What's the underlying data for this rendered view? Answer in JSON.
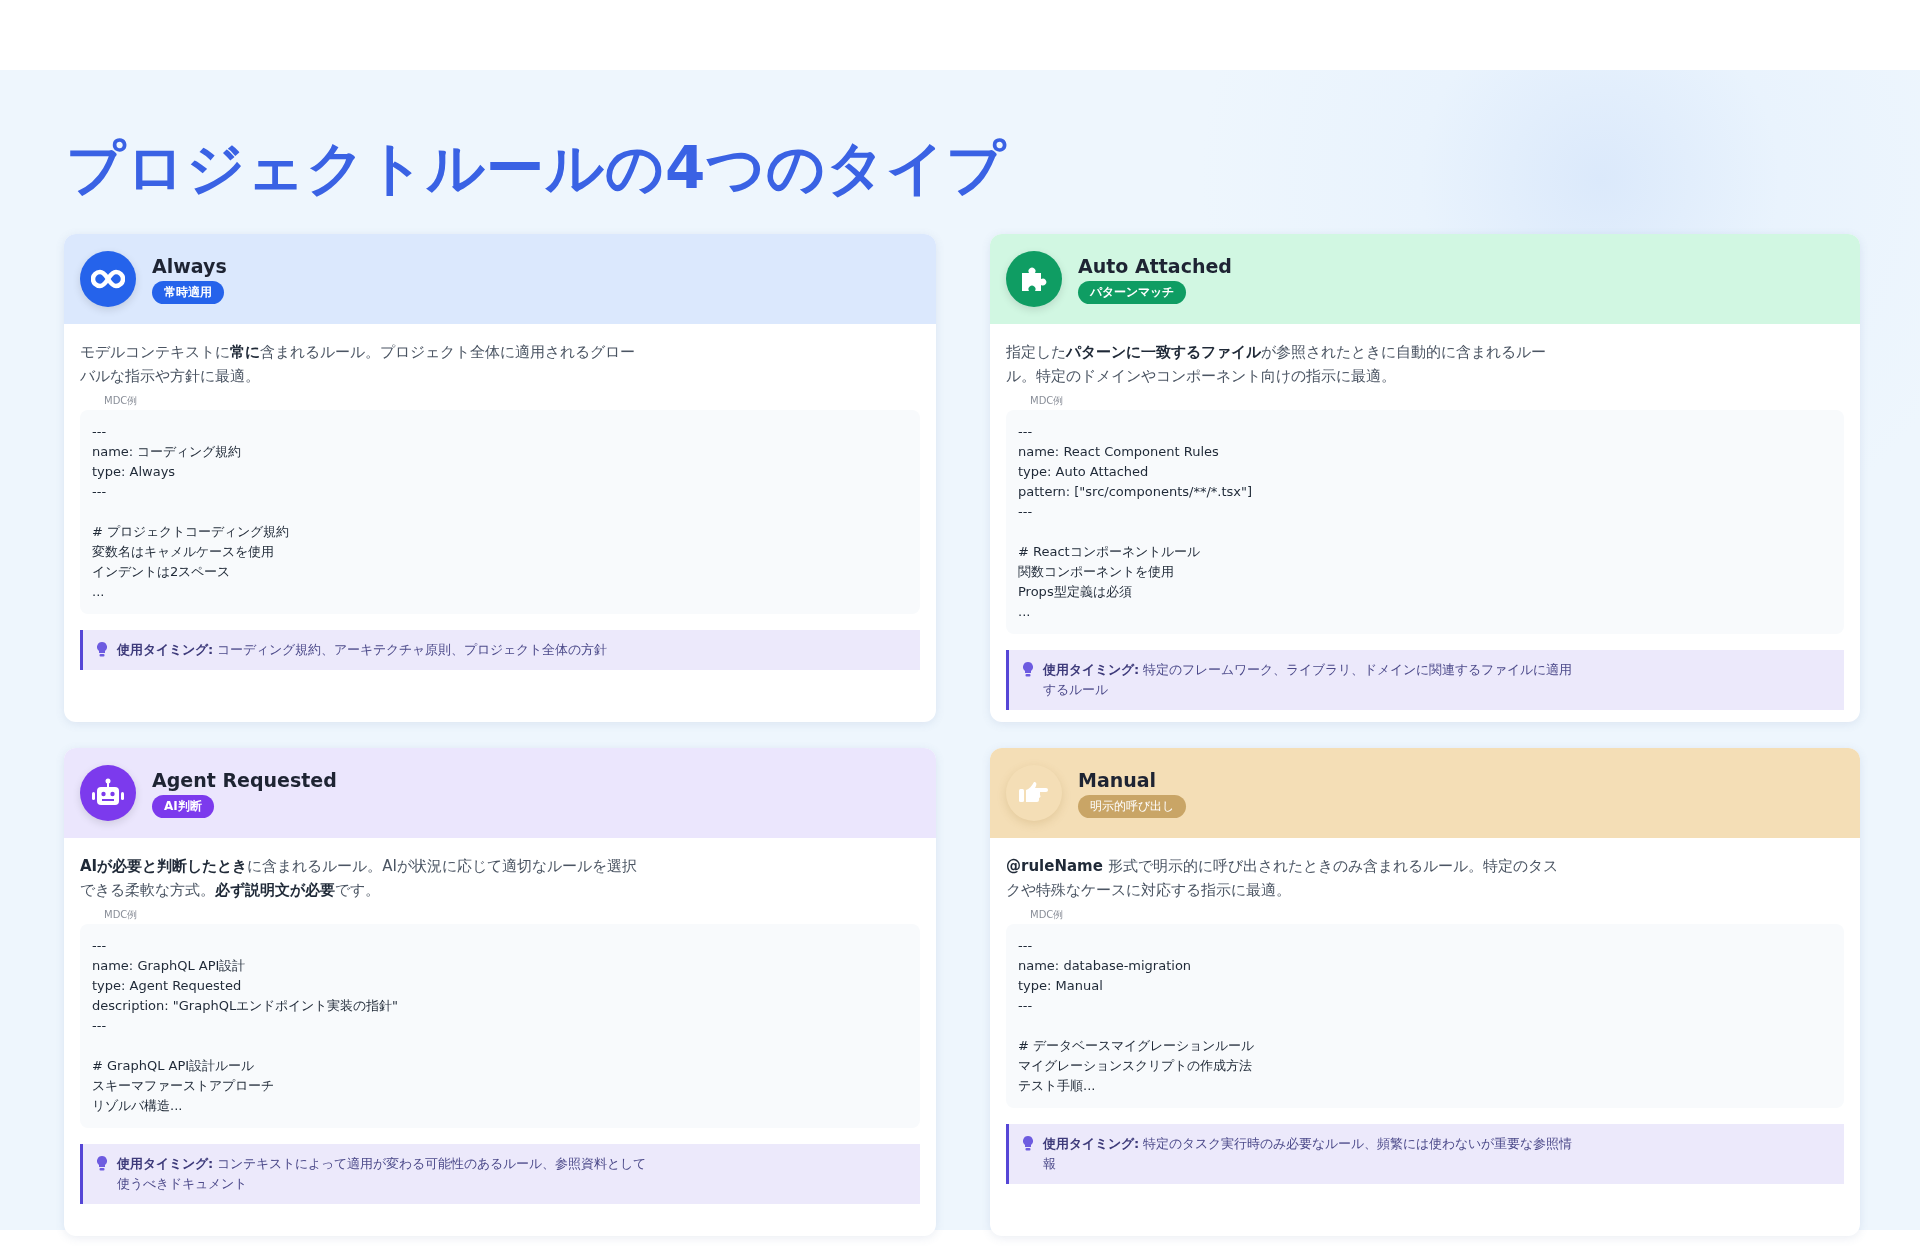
{
  "title": "プロジェクトルールの4つのタイプ",
  "cards": [
    {
      "kind": "infinity",
      "name": "Always",
      "badge": "常時適用",
      "badge_filled": true,
      "description": "モデルコンテキストに**常に**含まれるルール。プロジェクト全体に適用されるグローバルな指示や方針に最適。",
      "code_label": "MDC例",
      "code": [
        [
          "---",
          "name: コーディング規約",
          "type: Always",
          "---"
        ],
        [
          "# プロジェクトコーディング規約",
          "変数名はキャメルケースを使用",
          "インデントは2スペース",
          "..."
        ]
      ],
      "timing_label": "使用タイミング:",
      "timing": "コーディング規約、アーキテクチャ原則、プロジェクト全体の方針"
    },
    {
      "kind": "puzzle",
      "name": "Auto Attached",
      "badge": "パターンマッチ",
      "badge_filled": true,
      "description": "指定した**パターンに一致するファイル**が参照されたときに自動的に含まれるルール。特定のドメインやコンポーネント向けの指示に最適。",
      "code_label": "MDC例",
      "code": [
        [
          "---",
          "name: React Component Rules",
          "type: Auto Attached",
          "pattern: [\"src/components/**/*.tsx\"]",
          "---"
        ],
        [
          "# Reactコンポーネントルール",
          "関数コンポーネントを使用",
          "Props型定義は必須",
          "..."
        ]
      ],
      "timing_label": "使用タイミング:",
      "timing": "特定のフレームワーク、ライブラリ、ドメインに関連するファイルに適用するルール"
    },
    {
      "kind": "robot",
      "name": "Agent Requested",
      "badge": "AI判断",
      "badge_filled": true,
      "description": "**AIが必要と判断したとき**に含まれるルール。AIが状況に応じて適切なルールを選択できる柔軟な方式。**必ず説明文が必要**です。",
      "code_label": "MDC例",
      "code": [
        [
          "---",
          "name: GraphQL API設計",
          "type: Agent Requested",
          "description: \"GraphQLエンドポイント実装の指針\"",
          "---"
        ],
        [
          "# GraphQL API設計ルール",
          "スキーマファーストアプローチ",
          "リゾルバ構造..."
        ]
      ],
      "timing_label": "使用タイミング:",
      "timing": "コンテキストによって適用が変わる可能性のあるルール、参照資料として使うべきドキュメント"
    },
    {
      "kind": "hand",
      "name": "Manual",
      "badge": "明示的呼び出し",
      "badge_filled": false,
      "description": "**@ruleName** 形式で明示的に呼び出されたときのみ含まれるルール。特定のタスクや特殊なケースに対応する指示に最適。",
      "code_label": "MDC例",
      "code": [
        [
          "---",
          "name: database-migration",
          "type: Manual",
          "---"
        ],
        [
          "# データベースマイグレーションルール",
          "マイグレーションスクリプトの作成方法",
          "テスト手順..."
        ]
      ],
      "timing_label": "使用タイミング:",
      "timing": "特定のタスク実行時のみ必要なルール、頻繁には使わないが重要な参照情報"
    }
  ]
}
